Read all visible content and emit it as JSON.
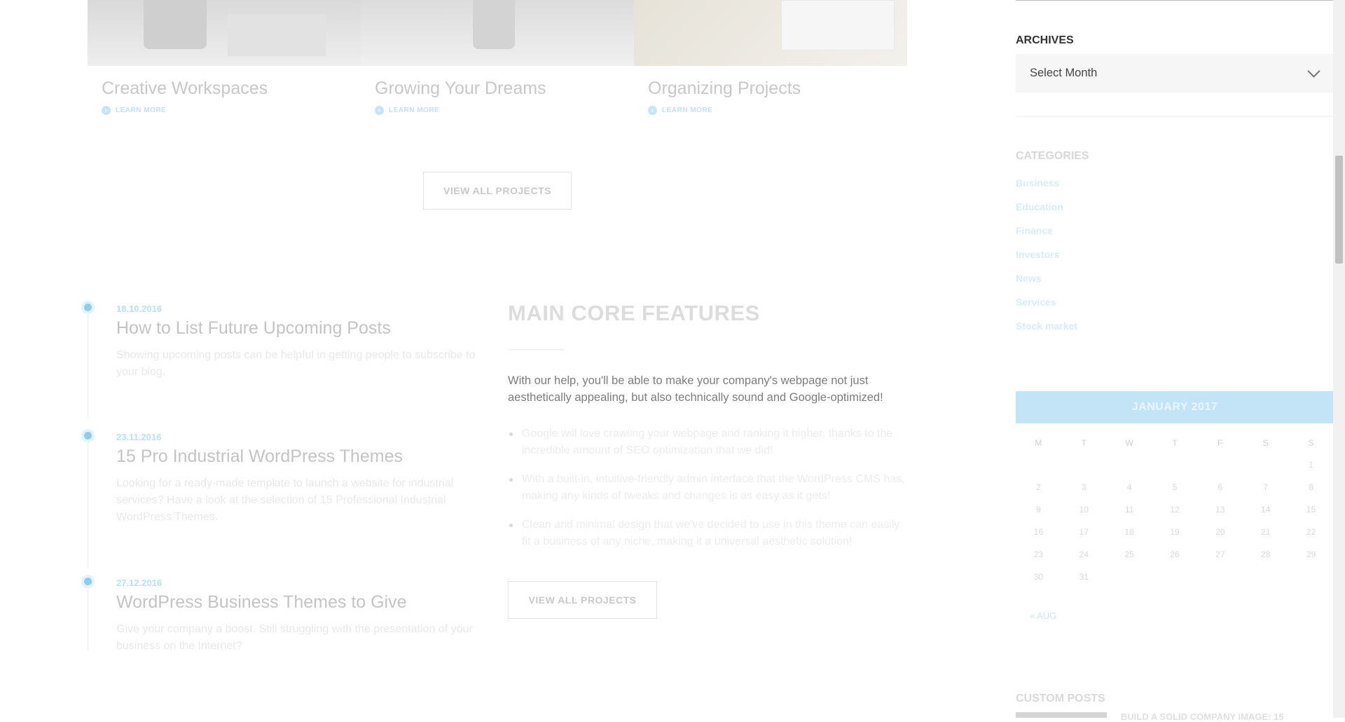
{
  "projects": {
    "cards": [
      {
        "title": "Creative Workspaces",
        "link": "LEARN MORE"
      },
      {
        "title": "Growing Your Dreams",
        "link": "LEARN MORE"
      },
      {
        "title": "Organizing Projects",
        "link": "LEARN MORE"
      }
    ],
    "view_all_label": "VIEW ALL PROJECTS"
  },
  "posts": [
    {
      "date": "18.10.2016",
      "title": "How to List Future Upcoming Posts",
      "excerpt": "Showing upcoming posts can be helpful in getting people to subscribe to your blog."
    },
    {
      "date": "23.11.2016",
      "title": "15 Pro Industrial WordPress Themes",
      "excerpt": "Looking for a ready-made template to launch a website for industrial services? Have a look at the selection of 15 Professional Industrial WordPress Themes."
    },
    {
      "date": "27.12.2016",
      "title": "WordPress Business Themes to Give",
      "excerpt": "Give your company a boost. Still struggling with the presentation of your business on the Internet?"
    }
  ],
  "features": {
    "title": "MAIN CORE FEATURES",
    "intro": "With our help, you'll be able to make your company's webpage not just aesthetically appealing, but also technically sound and Google-optimized!",
    "items": [
      "Google will love crawling your webpage and ranking it higher, thanks to the incredible amount of SEO optimization that we did!",
      "With a built-in, intuitive-friendly admin interface that the WordPress CMS has, making any kinds of tweaks and changes is as easy as it gets!",
      "Clean and minimal design that we've decided to use in this theme can easily fit a business of any niche, making it a universal aesthetic solution!"
    ],
    "button_label": "VIEW ALL PROJECTS"
  },
  "sidebar": {
    "archives": {
      "heading": "ARCHIVES",
      "select_value": "Select Month"
    },
    "categories": {
      "heading": "CATEGORIES",
      "items": [
        "Business",
        "Education",
        "Finance",
        "Investors",
        "News",
        "Services",
        "Stock market"
      ]
    },
    "calendar": {
      "month": "JANUARY 2017",
      "day_headers": [
        "M",
        "T",
        "W",
        "T",
        "F",
        "S",
        "S"
      ],
      "days": [
        "",
        "",
        "",
        "",
        "",
        "",
        "1",
        "2",
        "3",
        "4",
        "5",
        "6",
        "7",
        "8",
        "9",
        "10",
        "11",
        "12",
        "13",
        "14",
        "15",
        "16",
        "17",
        "18",
        "19",
        "20",
        "21",
        "22",
        "23",
        "24",
        "25",
        "26",
        "27",
        "28",
        "29",
        "30",
        "31",
        "",
        "",
        "",
        "",
        ""
      ],
      "prev_label": "« AUG"
    },
    "custom_posts": {
      "heading": "CUSTOM POSTS",
      "first_title": "BUILD A SOLID COMPANY IMAGE: 15"
    }
  },
  "colors": {
    "accent": "#8ccdf0",
    "accent_faded": "#c3e4f6"
  }
}
